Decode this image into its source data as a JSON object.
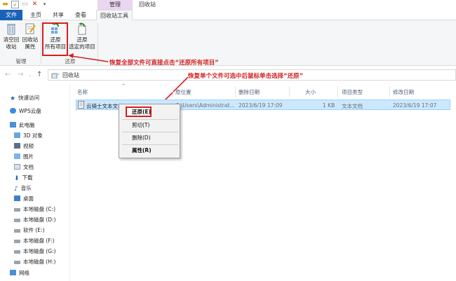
{
  "titlebar": {
    "context_group_label": "管理",
    "window_title": "回收站"
  },
  "tabs": [
    "文件",
    "主页",
    "共享",
    "查看",
    "回收站工具"
  ],
  "ribbon": {
    "empty_bin": "清空回\n收站",
    "bin_props": "回收站\n属性",
    "restore_all_line1": "还原",
    "restore_all_line2": "所有项目",
    "restore_sel_line1": "还原",
    "restore_sel_line2": "选定的项目",
    "group_manage": "管理",
    "group_restore": "还原"
  },
  "annotations": {
    "restore_all": "恢复全部文件可直接点击“还原所有项目”",
    "restore_single": "恢复单个文件可选中后鼠标单击选择“还原”"
  },
  "address": {
    "crumb": "回收站"
  },
  "sidebar": {
    "items": [
      "快速访问",
      "WPS云盘",
      "此电脑",
      "3D 对象",
      "视频",
      "图片",
      "文档",
      "下载",
      "音乐",
      "桌面",
      "本地磁盘 (C:)",
      "本地磁盘 (D:)",
      "软件 (E:)",
      "本地磁盘 (F:)",
      "本地磁盘 (G:)",
      "本地磁盘 (H:)",
      "网络"
    ]
  },
  "columns": [
    "名称",
    "原位置",
    "删除日期",
    "大小",
    "项目类型",
    "修改日期"
  ],
  "file": {
    "name": "云骑士文本文档",
    "location": "C:\\Users\\Administrat...",
    "deleted": "2023/6/19 17:09",
    "size": "1 KB",
    "type": "文本文档",
    "modified": "2023/6/19 17:07"
  },
  "context_menu": {
    "restore": "还原(E)",
    "cut": "剪切(T)",
    "delete": "删除(D)",
    "properties": "属性(R)"
  },
  "colors": {
    "accent": "#1a62b8",
    "annotation": "#d42020",
    "selection": "#cce8ff"
  }
}
